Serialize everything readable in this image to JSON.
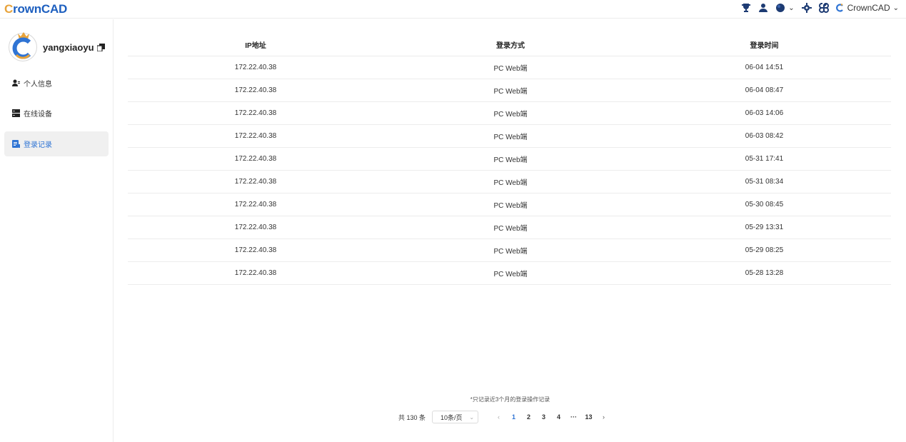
{
  "app": {
    "logo_prefix": "C",
    "logo_rest": "rownCAD",
    "brand_menu_label": "CrownCAD"
  },
  "user": {
    "name": "yangxiaoyu"
  },
  "sidebar": {
    "items": [
      {
        "label": "个人信息",
        "icon": "user-icon",
        "active": false
      },
      {
        "label": "在线设备",
        "icon": "device-icon",
        "active": false
      },
      {
        "label": "登录记录",
        "icon": "log-icon",
        "active": true
      }
    ]
  },
  "table": {
    "headers": [
      "IP地址",
      "登录方式",
      "登录时间"
    ],
    "rows": [
      [
        "172.22.40.38",
        "PC Web端",
        "06-04 14:51"
      ],
      [
        "172.22.40.38",
        "PC Web端",
        "06-04 08:47"
      ],
      [
        "172.22.40.38",
        "PC Web端",
        "06-03 14:06"
      ],
      [
        "172.22.40.38",
        "PC Web端",
        "06-03 08:42"
      ],
      [
        "172.22.40.38",
        "PC Web端",
        "05-31 17:41"
      ],
      [
        "172.22.40.38",
        "PC Web端",
        "05-31 08:34"
      ],
      [
        "172.22.40.38",
        "PC Web端",
        "05-30 08:45"
      ],
      [
        "172.22.40.38",
        "PC Web端",
        "05-29 13:31"
      ],
      [
        "172.22.40.38",
        "PC Web端",
        "05-29 08:25"
      ],
      [
        "172.22.40.38",
        "PC Web端",
        "05-28 13:28"
      ]
    ]
  },
  "footer": {
    "note": "*只记录近3个月的登录操作记录",
    "total": "共 130 条",
    "page_size": "10条/页",
    "pages": [
      "1",
      "2",
      "3",
      "4",
      "···",
      "13"
    ],
    "current_page": "1"
  },
  "colors": {
    "accent": "#2f74d4",
    "logo": "#1d5fbf",
    "border": "#ececec"
  }
}
